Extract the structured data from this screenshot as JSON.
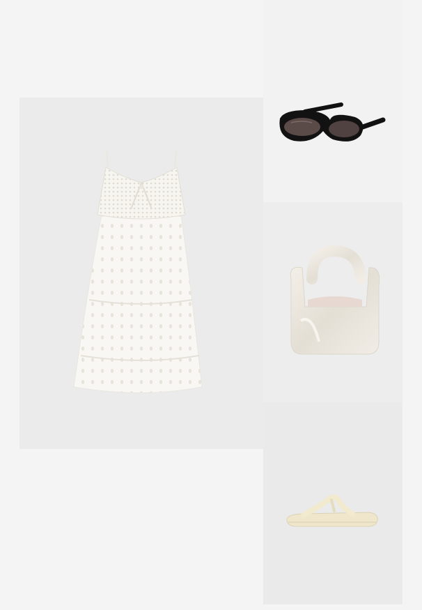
{
  "collage": {
    "items": [
      {
        "name": "white-crochet-mini-dress",
        "color": "#f7f6f1"
      },
      {
        "name": "black-oval-sunglasses",
        "color": "#111111"
      },
      {
        "name": "satin-shoulder-bag",
        "color": "#ece8e0"
      },
      {
        "name": "cream-flip-flop-sandal",
        "color": "#efe7cf"
      }
    ],
    "background_color": "#f4f4f4"
  }
}
